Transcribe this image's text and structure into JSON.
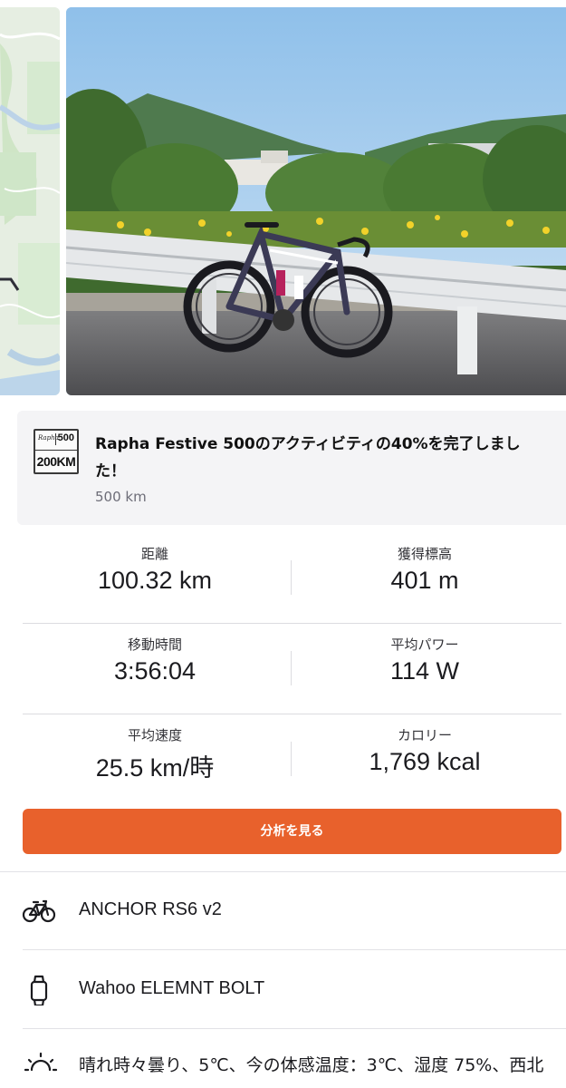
{
  "media": {
    "map_icon": "route-map-thumbnail",
    "photo_icon": "road-bike-photo"
  },
  "achievement": {
    "badge_brand": "Rapha",
    "badge_number": "500",
    "badge_distance": "200KM",
    "title": "Rapha Festive 500のアクティビティの40%を完了しました！",
    "subtitle": "500 km"
  },
  "stats": [
    {
      "left": {
        "label": "距離",
        "value": "100.32 km"
      },
      "right": {
        "label": "獲得標高",
        "value": "401 m"
      }
    },
    {
      "left": {
        "label": "移動時間",
        "value": "3:56:04"
      },
      "right": {
        "label": "平均パワー",
        "value": "114 W"
      }
    },
    {
      "left": {
        "label": "平均速度",
        "value": "25.5 km/時"
      },
      "right": {
        "label": "カロリー",
        "value": "1,769 kcal"
      }
    }
  ],
  "analyze_button": {
    "label": "分析を見る",
    "color": "#e8612c"
  },
  "gear": [
    {
      "icon": "bike-icon",
      "text": "ANCHOR RS6 v2"
    },
    {
      "icon": "watch-icon",
      "text": "Wahoo ELEMNT BOLT"
    }
  ],
  "weather": {
    "icon": "weather-sun-cloud-icon",
    "text": "晴れ時々曇り、5℃、今の体感温度：3℃、湿度 75%、西北"
  }
}
